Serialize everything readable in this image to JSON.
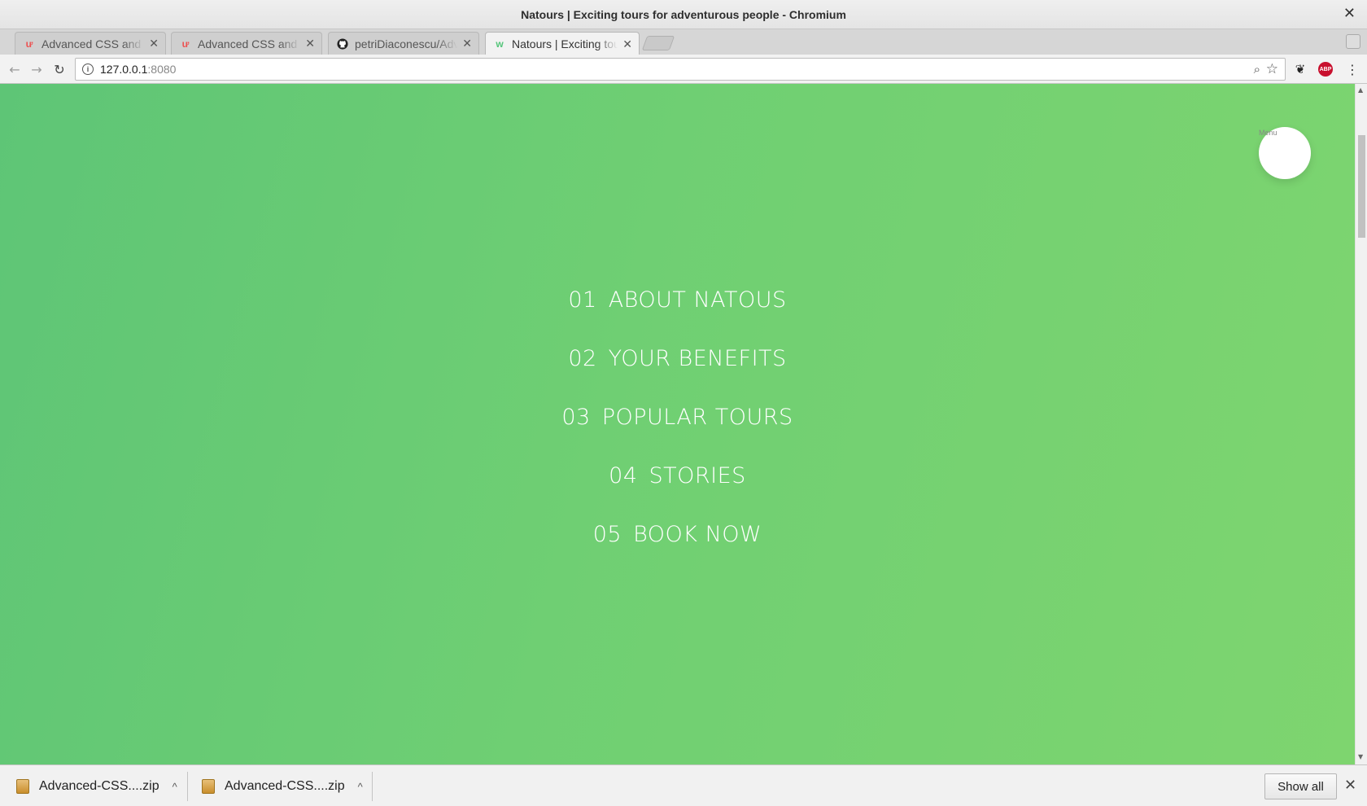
{
  "window": {
    "title": "Natours | Exciting tours for adventurous people - Chromium",
    "close_glyph": "✕"
  },
  "tabs": [
    {
      "label": "Advanced CSS and Sass",
      "icon": "udemy-icon",
      "active": false
    },
    {
      "label": "Advanced CSS and Sass",
      "icon": "udemy-icon",
      "active": false
    },
    {
      "label": "petriDiaconescu/Advanced-CSS",
      "icon": "github-icon",
      "active": false
    },
    {
      "label": "Natours | Exciting tours",
      "icon": "natours-icon",
      "active": true
    }
  ],
  "tab_close_glyph": "✕",
  "toolbar": {
    "back_glyph": "←",
    "forward_glyph": "→",
    "reload_glyph": "↻",
    "url_host": "127.0.0.1",
    "url_port": ":8080",
    "info_glyph": "i",
    "zoom_glyph": "⌕",
    "star_glyph": "☆",
    "extension_glyph": "❦",
    "abp_label": "ABP",
    "menu_glyph": "⋮"
  },
  "page": {
    "menu_caption": "Menu",
    "nav": [
      {
        "number": "01",
        "label": "ABOUT NATOUS"
      },
      {
        "number": "02",
        "label": "YOUR BENEFITS"
      },
      {
        "number": "03",
        "label": "POPULAR TOURS"
      },
      {
        "number": "04",
        "label": "STORIES"
      },
      {
        "number": "05",
        "label": "BOOK NOW"
      }
    ],
    "gradient_colors": [
      "#5ec576",
      "#7ed56f"
    ]
  },
  "scrollbar": {
    "up_glyph": "▲",
    "down_glyph": "▼"
  },
  "downloads": {
    "items": [
      {
        "filename": "Advanced-CSS....zip",
        "chevron": "^"
      },
      {
        "filename": "Advanced-CSS....zip",
        "chevron": "^"
      }
    ],
    "show_all_label": "Show all",
    "close_glyph": "✕"
  }
}
